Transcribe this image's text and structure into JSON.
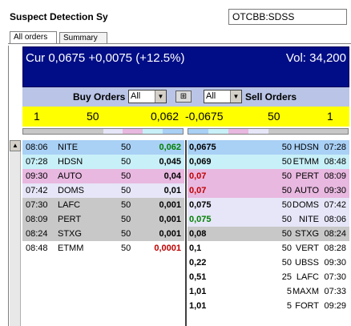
{
  "app": {
    "title": "Suspect Detection Sy",
    "symbol": "OTCBB:SDSS"
  },
  "tabs": [
    {
      "label": "All orders",
      "active": true
    },
    {
      "label": "Summary",
      "active": false
    }
  ],
  "header": {
    "cur_text": "Cur 0,0675 +0,0075 (+12.5%)",
    "vol_text": "Vol: 34,200"
  },
  "filters": {
    "buy_label": "Buy Orders",
    "buy_value": "All",
    "sell_value": "All",
    "sell_label": "Sell Orders"
  },
  "summary": {
    "buy_count": "1",
    "buy_size": "50",
    "buy_price": "0,062",
    "sell_price": "-0,0675",
    "sell_size": "50",
    "sell_count": "1"
  },
  "colors": {
    "blue_header": "#000d86",
    "yellow_bar": "#ffff00",
    "level1": "#a9d0f5",
    "level2": "#c8f0f8",
    "level3": "#e8b8e0",
    "level4": "#e6e6f8",
    "level5": "#c8c8c8",
    "price_green": "#008000",
    "price_red": "#c00000"
  },
  "strip_left": [
    "#c8c8c8",
    "#c8c8c8",
    "#c8c8c8",
    "#c8c8c8",
    "#e6e6f8",
    "#e8b8e0",
    "#c8f0f8",
    "#a9d0f5"
  ],
  "strip_right": [
    "#a9d0f5",
    "#c8f0f8",
    "#e8b8e0",
    "#e6e6f8",
    "#c8c8c8",
    "#c8c8c8",
    "#c8c8c8",
    "#c8c8c8"
  ],
  "bids": [
    {
      "time": "08:06",
      "mm": "NITE",
      "size": "50",
      "price": "0,062",
      "bg": "#a9d0f5",
      "pc": "#008000"
    },
    {
      "time": "07:28",
      "mm": "HDSN",
      "size": "50",
      "price": "0,045",
      "bg": "#c8f0f8",
      "pc": "#000000"
    },
    {
      "time": "09:30",
      "mm": "AUTO",
      "size": "50",
      "price": "0,04",
      "bg": "#e8b8e0",
      "pc": "#000000"
    },
    {
      "time": "07:42",
      "mm": "DOMS",
      "size": "50",
      "price": "0,01",
      "bg": "#e6e6f8",
      "pc": "#000000"
    },
    {
      "time": "07:30",
      "mm": "LAFC",
      "size": "50",
      "price": "0,001",
      "bg": "#c8c8c8",
      "pc": "#000000"
    },
    {
      "time": "08:09",
      "mm": "PERT",
      "size": "50",
      "price": "0,001",
      "bg": "#c8c8c8",
      "pc": "#000000"
    },
    {
      "time": "08:24",
      "mm": "STXG",
      "size": "50",
      "price": "0,001",
      "bg": "#c8c8c8",
      "pc": "#000000"
    },
    {
      "time": "08:48",
      "mm": "ETMM",
      "size": "50",
      "price": "0,0001",
      "bg": "#ffffff",
      "pc": "#c00000"
    }
  ],
  "asks": [
    {
      "price": "0,0675",
      "size": "50",
      "mm": "HDSN",
      "time": "07:28",
      "bg": "#a9d0f5",
      "pc": "#000000"
    },
    {
      "price": "0,069",
      "size": "50",
      "mm": "ETMM",
      "time": "08:48",
      "bg": "#c8f0f8",
      "pc": "#000000"
    },
    {
      "price": "0,07",
      "size": "50",
      "mm": "PERT",
      "time": "08:09",
      "bg": "#e8b8e0",
      "pc": "#c00000"
    },
    {
      "price": "0,07",
      "size": "50",
      "mm": "AUTO",
      "time": "09:30",
      "bg": "#e8b8e0",
      "pc": "#c00000"
    },
    {
      "price": "0,075",
      "size": "50",
      "mm": "DOMS",
      "time": "07:42",
      "bg": "#e6e6f8",
      "pc": "#000000"
    },
    {
      "price": "0,075",
      "size": "50",
      "mm": "NITE",
      "time": "08:06",
      "bg": "#e6e6f8",
      "pc": "#008000"
    },
    {
      "price": "0,08",
      "size": "50",
      "mm": "STXG",
      "time": "08:24",
      "bg": "#c8c8c8",
      "pc": "#000000"
    },
    {
      "price": "0,1",
      "size": "50",
      "mm": "VERT",
      "time": "08:28",
      "bg": "#ffffff",
      "pc": "#000000"
    },
    {
      "price": "0,22",
      "size": "50",
      "mm": "UBSS",
      "time": "09:30",
      "bg": "#ffffff",
      "pc": "#000000"
    },
    {
      "price": "0,51",
      "size": "25",
      "mm": "LAFC",
      "time": "07:30",
      "bg": "#ffffff",
      "pc": "#000000"
    },
    {
      "price": "1,01",
      "size": "5",
      "mm": "MAXM",
      "time": "07:33",
      "bg": "#ffffff",
      "pc": "#000000"
    },
    {
      "price": "1,01",
      "size": "5",
      "mm": "FORT",
      "time": "09:29",
      "bg": "#ffffff",
      "pc": "#000000"
    }
  ]
}
